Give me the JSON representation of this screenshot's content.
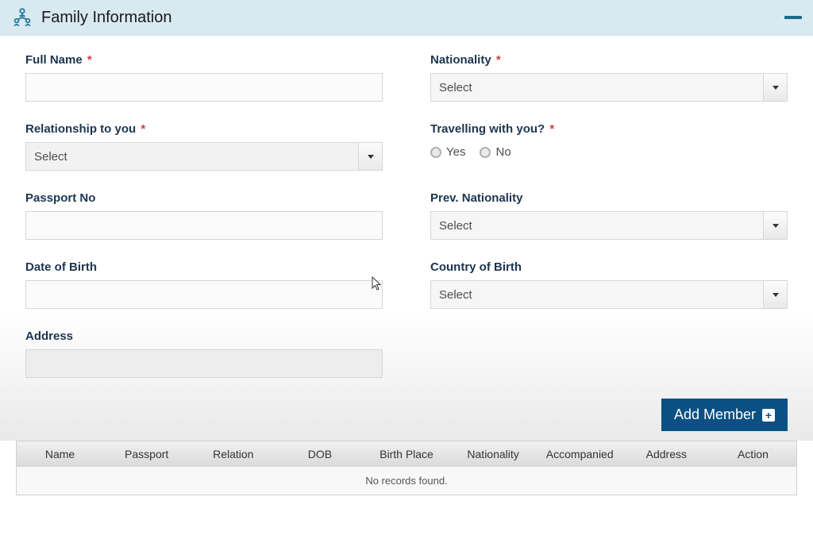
{
  "panel": {
    "title": "Family Information"
  },
  "form": {
    "full_name": {
      "label": "Full Name",
      "required": "*",
      "value": ""
    },
    "nationality": {
      "label": "Nationality",
      "required": "*",
      "placeholder": "Select"
    },
    "relationship": {
      "label": "Relationship to you",
      "required": "*",
      "placeholder": "Select"
    },
    "travelling": {
      "label": "Travelling with you?",
      "required": "*",
      "yes": "Yes",
      "no": "No"
    },
    "passport_no": {
      "label": "Passport No",
      "value": ""
    },
    "prev_nationality": {
      "label": "Prev. Nationality",
      "placeholder": "Select"
    },
    "dob": {
      "label": "Date of Birth",
      "value": ""
    },
    "cob": {
      "label": "Country of Birth",
      "placeholder": "Select"
    },
    "address": {
      "label": "Address",
      "value": ""
    }
  },
  "actions": {
    "add_member": "Add Member"
  },
  "table": {
    "headers": {
      "name": "Name",
      "passport": "Passport",
      "relation": "Relation",
      "dob": "DOB",
      "birth_place": "Birth Place",
      "nationality": "Nationality",
      "accompanied": "Accompanied",
      "address": "Address",
      "action": "Action"
    },
    "empty": "No records found."
  }
}
